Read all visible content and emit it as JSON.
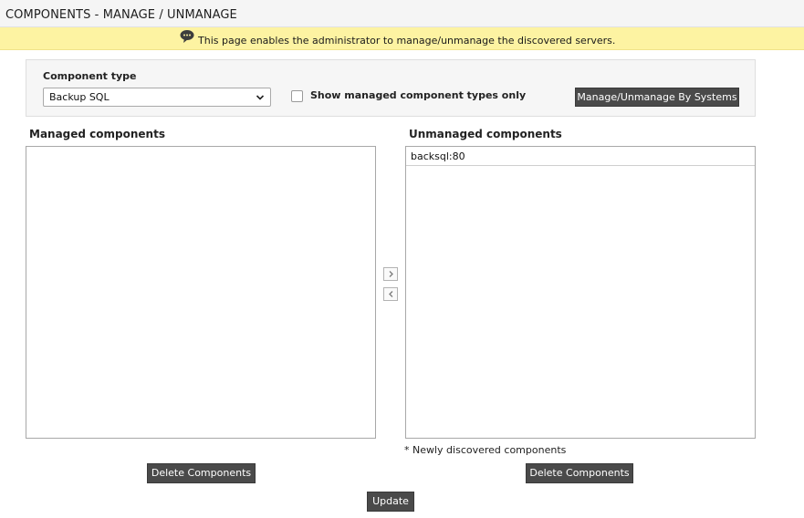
{
  "header": {
    "title": "COMPONENTS - MANAGE / UNMANAGE"
  },
  "banner": {
    "icon": "speech-bubble-icon",
    "text": "This page enables the administrator to manage/unmanage the discovered servers."
  },
  "filter": {
    "component_type_label": "Component type",
    "component_type_selected": "Backup SQL",
    "managed_only_label": "Show managed component types only",
    "managed_only_checked": false,
    "by_systems_button": "Manage/Unmanage By Systems"
  },
  "managed": {
    "heading": "Managed components",
    "items": []
  },
  "unmanaged": {
    "heading": "Unmanaged components",
    "items": [
      "backsql:80"
    ]
  },
  "footnote": "* Newly discovered components",
  "actions": {
    "delete_managed": "Delete Components",
    "delete_unmanaged": "Delete Components",
    "update": "Update"
  },
  "colors": {
    "banner_bg": "#fdf3a2",
    "button_bg": "#4a4a4a"
  }
}
